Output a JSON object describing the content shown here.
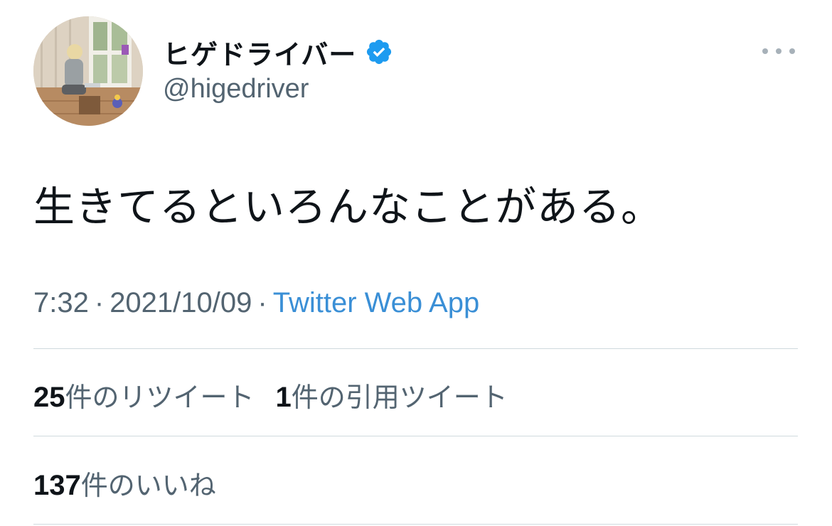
{
  "author": {
    "display_name": "ヒゲドライバー",
    "handle": "@higedriver",
    "verified": true,
    "avatar": "photo of person sitting with laptop in a wooden room"
  },
  "more_menu_icon": "more-horizontal-icon",
  "tweet": {
    "text": "生きてるといろんなことがある。",
    "time": "7:32",
    "separator": "·",
    "date": "2021/10/09",
    "source": "Twitter Web App"
  },
  "stats": {
    "retweets_count": "25",
    "retweets_label": "件のリツイート",
    "quotes_count": "1",
    "quotes_label": "件の引用ツイート",
    "likes_count": "137",
    "likes_label": "件のいいね"
  },
  "colors": {
    "text_primary": "#0f1419",
    "text_secondary": "#536471",
    "link": "#3a8fd6",
    "verified": "#1d9bf0",
    "divider": "#cfd9de"
  }
}
